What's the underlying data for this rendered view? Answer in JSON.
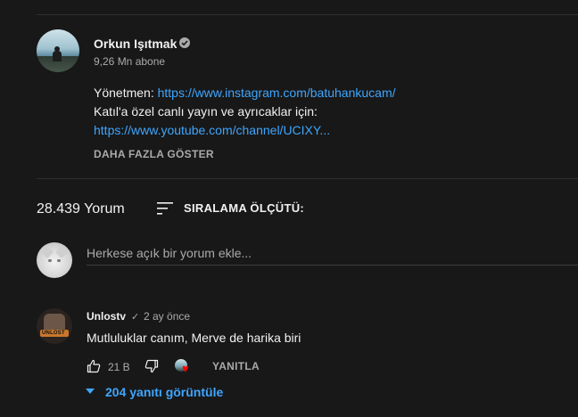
{
  "channel": {
    "name": "Orkun Işıtmak",
    "subscribers": "9,26 Mn abone",
    "description": {
      "line1_prefix": "Yönetmen: ",
      "line1_link": "https://www.instagram.com/batuhankucam/",
      "line2": "Katıl'a özel canlı yayın ve ayrıcaklar için:",
      "line3_link": "https://www.youtube.com/channel/UCIXY..."
    },
    "show_more_label": "DAHA FAZLA GÖSTER"
  },
  "comments_header": {
    "count": "28.439 Yorum",
    "sort_label": "SIRALAMA ÖLÇÜTÜ:"
  },
  "add_comment": {
    "placeholder": "Herkese açık bir yorum ekle..."
  },
  "comment": {
    "author": "Unlostv",
    "check": "✓",
    "time": "2 ay önce",
    "text": "Mutluluklar canım, Merve de harika biri",
    "likes": "21 B",
    "reply_label": "YANITLA",
    "view_replies": "204 yanıtı görüntüle",
    "avatar_text": "UNLOST"
  },
  "colors": {
    "background": "#181818",
    "link": "#3ea6ff",
    "secondary_text": "#aaaaaa",
    "heart": "#ff0000"
  }
}
